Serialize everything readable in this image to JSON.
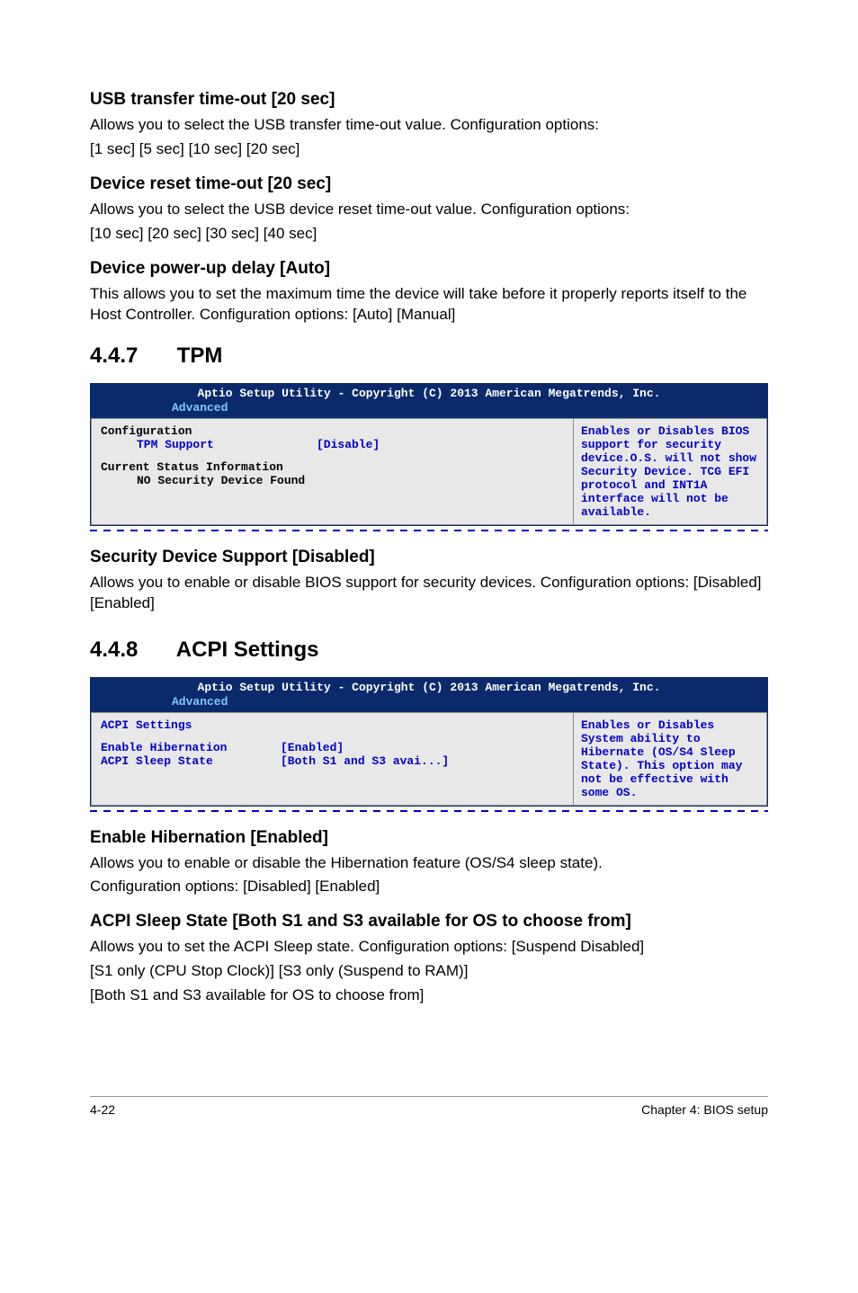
{
  "sections": {
    "usb_transfer": {
      "heading": "USB transfer time-out [20 sec]",
      "body1": "Allows you to select the USB transfer time-out value. Configuration options:",
      "body2": "[1 sec] [5 sec]  [10 sec] [20 sec]"
    },
    "device_reset": {
      "heading": "Device reset time-out [20 sec]",
      "body1": "Allows you to select the USB device reset time-out value. Configuration options:",
      "body2": "[10 sec] [20 sec] [30 sec] [40 sec]"
    },
    "device_powerup": {
      "heading": "Device power-up delay [Auto]",
      "body1": "This allows you to set the maximum time the device will take before it properly reports itself to the Host Controller. Configuration options: [Auto] [Manual]"
    },
    "tpm": {
      "number": "4.4.7",
      "title": "TPM",
      "sub_heading": "Security Device Support [Disabled]",
      "sub_body": "Allows you to enable or disable BIOS support for security devices. Configuration options: [Disabled] [Enabled]"
    },
    "acpi": {
      "number": "4.4.8",
      "title": "ACPI Settings",
      "enable_hib_heading": "Enable Hibernation [Enabled]",
      "enable_hib_body1": "Allows you to enable or disable the Hibernation feature (OS/S4 sleep state).",
      "enable_hib_body2": "Configuration options: [Disabled] [Enabled]",
      "sleep_heading": "ACPI Sleep State [Both S1 and S3 available for OS to choose from]",
      "sleep_body1": "Allows you to set the ACPI Sleep state. Configuration options: [Suspend Disabled]",
      "sleep_body2": "[S1 only (CPU Stop Clock)] [S3 only (Suspend to RAM)]",
      "sleep_body3": "[Both S1 and S3 available for OS to choose from]"
    }
  },
  "bios": {
    "header_title": "Aptio Setup Utility - Copyright (C) 2013 American Megatrends, Inc.",
    "tab_active": "Advanced",
    "tpm": {
      "configuration": "Configuration",
      "tpm_support_key": "TPM Support",
      "tpm_support_val": "[Disable]",
      "status_line": "Current Status Information",
      "no_device": "NO Security Device Found",
      "help": "Enables or Disables BIOS support for security device.O.S. will not show Security Device. TCG EFI protocol and INT1A interface will not be available."
    },
    "acpi": {
      "title_line": "ACPI Settings",
      "enable_hib_key": "Enable Hibernation",
      "enable_hib_val": "[Enabled]",
      "sleep_key": "ACPI Sleep State",
      "sleep_val": "[Both S1 and S3 avai...]",
      "help": "Enables or Disables System ability to Hibernate (OS/S4 Sleep State). This option may not be effective with some OS."
    }
  },
  "footer": {
    "page": "4-22",
    "chapter": "Chapter 4: BIOS setup"
  }
}
